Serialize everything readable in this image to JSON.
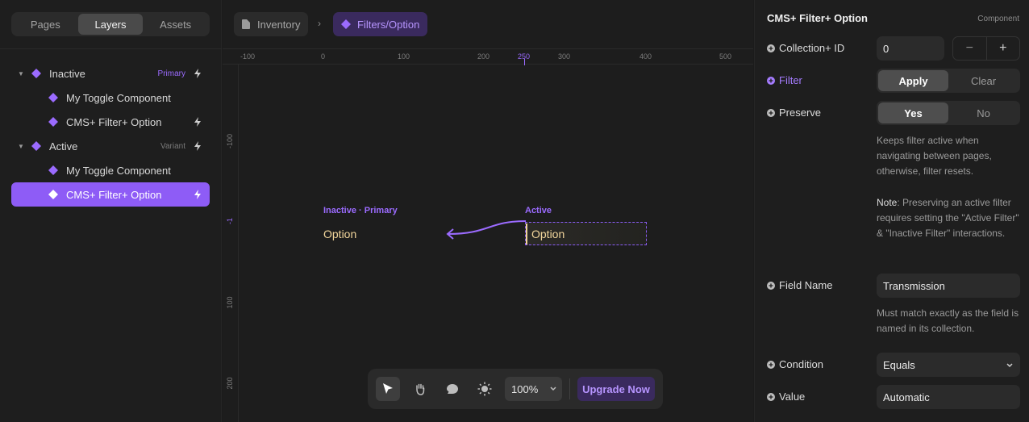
{
  "left_panel": {
    "tabs": [
      "Pages",
      "Layers",
      "Assets"
    ],
    "layers": [
      {
        "label": "Inactive",
        "tag": "Primary",
        "expandable": true
      },
      {
        "label": "My Toggle Component"
      },
      {
        "label": "CMS+ Filter+ Option"
      },
      {
        "label": "Active",
        "tag": "Variant",
        "expandable": true
      },
      {
        "label": "My Toggle Component"
      },
      {
        "label": "CMS+ Filter+ Option",
        "selected": true
      }
    ]
  },
  "canvas": {
    "breadcrumb": {
      "page": "Inventory",
      "component": "Filters/Option"
    },
    "ruler_x": [
      "-100",
      "0",
      "100",
      "200",
      "250",
      "300",
      "400",
      "500"
    ],
    "ruler_y": [
      "-100",
      "-1",
      "100",
      "200"
    ],
    "variants": {
      "inactive_label": "Inactive · Primary",
      "inactive_text": "Option",
      "active_label": "Active",
      "active_text": "Option"
    },
    "toolbar": {
      "zoom": "100%",
      "upgrade": "Upgrade Now"
    }
  },
  "right_panel": {
    "title": "CMS+ Filter+ Option",
    "kind": "Component",
    "collection_id": {
      "label": "Collection+ ID",
      "value": "0",
      "minus": "−",
      "plus": "+"
    },
    "filter": {
      "label": "Filter",
      "options": [
        "Apply",
        "Clear"
      ],
      "selected": "Apply"
    },
    "preserve": {
      "label": "Preserve",
      "options": [
        "Yes",
        "No"
      ],
      "selected": "Yes"
    },
    "preserve_help": "Keeps filter active when navigating between pages, otherwise, filter resets.",
    "note_label": "Note",
    "note_text": ": Preserving an active filter requires setting the \"Active Filter\" & \"Inactive Filter\" interactions.",
    "field_name": {
      "label": "Field Name",
      "value": "Transmission"
    },
    "field_help": "Must match exactly as the field is named in its collection.",
    "condition": {
      "label": "Condition",
      "value": "Equals"
    },
    "value": {
      "label": "Value",
      "value": "Automatic"
    }
  },
  "colors": {
    "accent": "#8e5cf6",
    "option_text": "#f1d59b"
  }
}
